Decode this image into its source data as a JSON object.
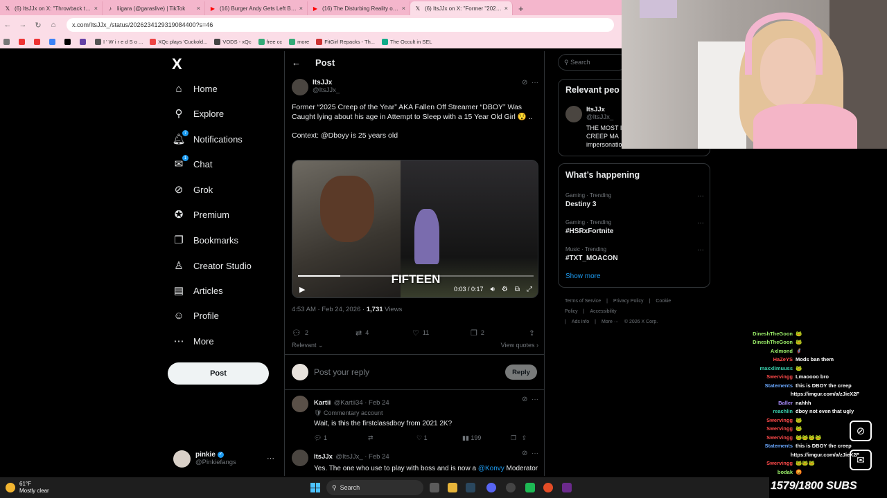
{
  "browser": {
    "tabs": [
      {
        "icon": "x-icon",
        "title": "(6) ItsJJx on X: \"Throwback to w",
        "active": false
      },
      {
        "icon": "tiktok-icon",
        "title": "liigara (@garaslive) | TikTok",
        "active": false
      },
      {
        "icon": "youtube-icon",
        "title": "(16) Burger Andy Gets Left Beh",
        "active": false
      },
      {
        "icon": "youtube-icon",
        "title": "(16) The Disturbing Reality of Th",
        "active": false
      },
      {
        "icon": "x-icon",
        "title": "(6) ItsJJx on X: \"Former \"2025 C",
        "active": true
      }
    ],
    "close_glyph": "×",
    "new_tab_glyph": "+",
    "url": "x.com/ItsJJx_/status/2026234129319084400?s=46",
    "bookmarks": [
      "I ' W i r e d   S o ...",
      "XQc plays 'Cuckold...",
      "VODS - xQc",
      "free cc",
      "more",
      "FitGirl Repacks - Th...",
      "The Occult in SEL"
    ]
  },
  "sidebar": {
    "logo": "X",
    "items": [
      {
        "label": "Home",
        "icon": "home-icon",
        "glyph": "⌂"
      },
      {
        "label": "Explore",
        "icon": "search-icon",
        "glyph": "⚲"
      },
      {
        "label": "Notifications",
        "icon": "bell-icon",
        "glyph": "🔔︎",
        "badge": "7"
      },
      {
        "label": "Chat",
        "icon": "mail-icon",
        "glyph": "✉",
        "badge": "1"
      },
      {
        "label": "Grok",
        "icon": "grok-icon",
        "glyph": "⊘"
      },
      {
        "label": "Premium",
        "icon": "verified-icon",
        "glyph": "✪"
      },
      {
        "label": "Bookmarks",
        "icon": "bookmark-icon",
        "glyph": "❐"
      },
      {
        "label": "Creator Studio",
        "icon": "creator-icon",
        "glyph": "♙"
      },
      {
        "label": "Articles",
        "icon": "articles-icon",
        "glyph": "▤"
      },
      {
        "label": "Profile",
        "icon": "profile-icon",
        "glyph": "☺"
      },
      {
        "label": "More",
        "icon": "more-icon",
        "glyph": "⋯"
      }
    ],
    "post_button": "Post",
    "account": {
      "name": "pinkie",
      "handle": "@Pinkiefangs",
      "menu": "···"
    }
  },
  "main": {
    "header_title": "Post",
    "tweet": {
      "name": "ItsJJx",
      "handle": "@ItsJJx_",
      "text": "Former “2025 Creep of the Year” AKA Fallen Off Streamer “DBOY” Was Caught lying about his age in Attempt to Sleep with a 15 Year Old Girl 😯 ..",
      "context": "Context: @Dboyy is 25 years old",
      "video": {
        "caption": "FIFTEEN",
        "time": "0:03 / 0:17",
        "progress": 0.18
      },
      "time": "4:53 AM · Feb 24, 2026 · ",
      "views_count": "1,731",
      "views_label": " Views",
      "replies": "2",
      "reposts": "4",
      "likes": "11",
      "bookmarks": "2",
      "relevant": "Relevant ⌄",
      "view_quotes": "View quotes ›"
    },
    "reply_placeholder": "Post your reply",
    "reply_button": "Reply",
    "replies": [
      {
        "name": "Kartii",
        "handle": "@Kartii34 · Feb 24",
        "badge": "Commentary account",
        "text": "Wait, is this the firstclassdboy from 2021 2K?",
        "replies": "1",
        "reposts": "",
        "likes": "1",
        "views": "199"
      },
      {
        "name": "ItsJJx",
        "handle": "@ItsJJx_ · Feb 24",
        "text_before": "Yes. The one who use to play with boss and is now a ",
        "mention": "@Konvy",
        "text_after": " Moderator ."
      }
    ]
  },
  "right": {
    "search_placeholder": "Search",
    "relevant_title": "Relevant peo",
    "relevant_person": {
      "name": "ItsJJx",
      "handle": "@ItsJJx_",
      "bio": "THE MOST I | CREEP MA impersonatio"
    },
    "trending_title": "What’s happening",
    "trends": [
      {
        "category": "Gaming · Trending",
        "title": "Destiny 3"
      },
      {
        "category": "Gaming · Trending",
        "title": "#HSRxFortnite"
      },
      {
        "category": "Music · Trending",
        "title": "#TXT_MOACON"
      }
    ],
    "show_more": "Show more",
    "footer": [
      "Terms of Service",
      "|",
      "Privacy Policy",
      "|",
      "Cookie Policy",
      "|",
      "Accessibility",
      "|",
      "Ads info",
      "|",
      "More ···",
      "© 2026 X Corp."
    ]
  },
  "chat": [
    {
      "user": "DineshTheGoon",
      "color": "#9cf06a",
      "msg": "🐸"
    },
    {
      "user": "DineshTheGoon",
      "color": "#9cf06a",
      "msg": "🐸"
    },
    {
      "user": "Axlmond",
      "color": "#9cf06a",
      "msg": "🦸"
    },
    {
      "user": "HaZeYS",
      "color": "#ff4a4a",
      "msg": "Mods ban them"
    },
    {
      "user": "maxxlimuuss",
      "color": "#3ad3b0",
      "msg": "🐸"
    },
    {
      "user": "Swervingg",
      "color": "#ff4a4a",
      "msg": "Lmaoooo bro"
    },
    {
      "user": "Statements",
      "color": "#6aa8ff",
      "msg": "this is DBOY the creep"
    },
    {
      "user": "",
      "color": "#6aa8ff",
      "msg": "https://imgur.com/a/zJieX2F"
    },
    {
      "user": "Baller",
      "color": "#a78bfa",
      "msg": "nahhh"
    },
    {
      "user": "reachlin",
      "color": "#3ad3b0",
      "msg": "dboy not even that ugly"
    },
    {
      "user": "Swervingg",
      "color": "#ff4a4a",
      "msg": "🐸"
    },
    {
      "user": "Swervingg",
      "color": "#ff4a4a",
      "msg": "🐸"
    },
    {
      "user": "Swervingg",
      "color": "#ff4a4a",
      "msg": "🐸🐸🐸🐸"
    },
    {
      "user": "Statements",
      "color": "#6aa8ff",
      "msg": "this is DBOY the creep"
    },
    {
      "user": "",
      "color": "#6aa8ff",
      "msg": "https://imgur.com/a/zJieX2F"
    },
    {
      "user": "Swervingg",
      "color": "#ff4a4a",
      "msg": "🐸🐸🐸"
    },
    {
      "user": "bodak",
      "color": "#9cf06a",
      "msg": "😡"
    }
  ],
  "sub_goal": "1579/1800 SUBS",
  "taskbar": {
    "temp": "61°F",
    "condition": "Mostly clear",
    "search": "Search"
  }
}
